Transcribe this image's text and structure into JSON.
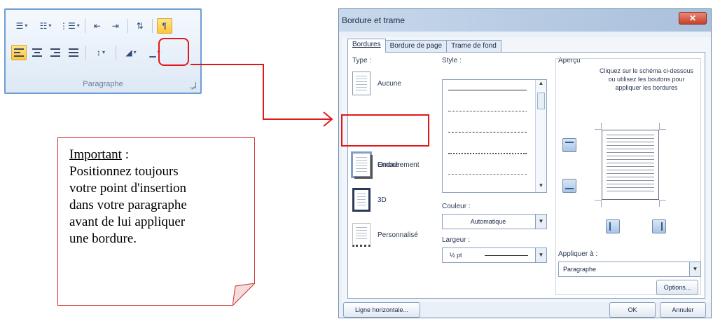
{
  "ribbon": {
    "group_label": "Paragraphe",
    "row1": [
      {
        "name": "bullets-button",
        "icon": "bullets-icon",
        "glyph": "☰",
        "dropdown": true
      },
      {
        "name": "numbering-button",
        "icon": "numbering-icon",
        "glyph": "☷",
        "dropdown": true
      },
      {
        "name": "multilevel-list-button",
        "icon": "multilevel-list-icon",
        "glyph": "⋮☰",
        "dropdown": true
      },
      {
        "name": "decrease-indent-button",
        "icon": "decrease-indent-icon",
        "glyph": "⇤"
      },
      {
        "name": "increase-indent-button",
        "icon": "increase-indent-icon",
        "glyph": "⇥"
      },
      {
        "name": "sort-button",
        "icon": "sort-icon",
        "glyph": "⇅"
      },
      {
        "name": "show-marks-button",
        "icon": "pilcrow-icon",
        "glyph": "¶",
        "active": true
      }
    ],
    "row2_align": [
      "align-left",
      "align-center",
      "align-right",
      "justify"
    ],
    "line_spacing_glyph": "↕",
    "shading_glyph": "◢",
    "border_glyph": "▁",
    "accent_active": "#ffc53a"
  },
  "note": {
    "title": "Important",
    "title_suffix": " :",
    "lines": [
      "Positionnez toujours",
      "votre point d'insertion",
      "dans votre paragraphe",
      "avant de lui appliquer",
      "une bordure."
    ],
    "border_color": "#d23030"
  },
  "dialog": {
    "title": "Bordure et trame",
    "close_glyph": "✕",
    "tabs": [
      "Bordures",
      "Bordure de page",
      "Trame de fond"
    ],
    "active_tab": 0,
    "type_label": "Type :",
    "types": [
      {
        "label": "Aucune",
        "style": "none"
      },
      {
        "label": "Encadrement",
        "style": "box",
        "selected": true
      },
      {
        "label": "Ombre",
        "style": "shadow"
      },
      {
        "label": "3D",
        "style": "thick"
      },
      {
        "label": "Personnalisé",
        "style": "custom"
      }
    ],
    "style_label": "Style :",
    "styles": [
      "solid",
      "dotted",
      "dashed",
      "dash-dot",
      "dash-dot-dot"
    ],
    "color_label": "Couleur :",
    "color_value": "Automatique",
    "width_label": "Largeur :",
    "width_value": "½ pt",
    "preview_label": "Aperçu",
    "preview_hint": "Cliquez sur le schéma ci-dessous ou utilisez les boutons pour appliquer les bordures",
    "apply_label": "Appliquer à :",
    "apply_value": "Paragraphe",
    "options_button": "Options...",
    "horizontal_line_button": "Ligne horizontale...",
    "ok_button": "OK",
    "cancel_button": "Annuler",
    "highlight_color": "#e01818"
  }
}
